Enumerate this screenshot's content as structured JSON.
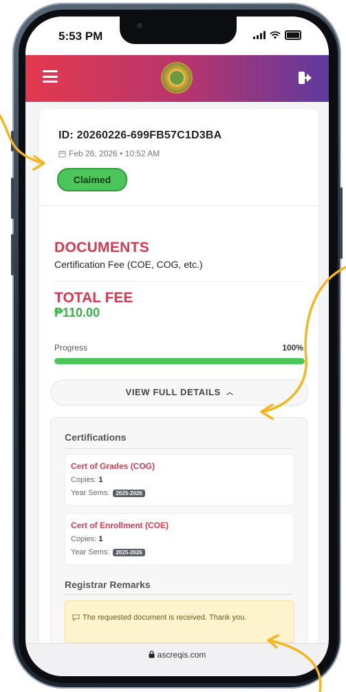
{
  "status_bar": {
    "time": "5:53 PM"
  },
  "header": {
    "menu_icon": "hamburger-icon",
    "logo_icon": "college-seal-logo",
    "logout_icon": "logout-icon"
  },
  "request": {
    "id_label": "ID: 20260226-699FB57C1D3BA",
    "date": "Feb 26, 2026 • 10:52 AM",
    "status": "Claimed"
  },
  "category": {
    "title": "DOCUMENTS",
    "subtitle": "Certification Fee (COE, COG, etc.)"
  },
  "total": {
    "label": "TOTAL FEE",
    "value": "₱110.00"
  },
  "progress": {
    "label": "Progress",
    "value_text": "100%",
    "percent": 100
  },
  "view_details": {
    "label": "VIEW FULL DETAILS"
  },
  "details": {
    "certifications_title": "Certifications",
    "certifications": [
      {
        "name": "Cert of Grades (COG)",
        "copies_label": "Copies:",
        "copies": "1",
        "year_label": "Year Sems:",
        "year": "2025-2026"
      },
      {
        "name": "Cert of Enrollment (COE)",
        "copies_label": "Copies:",
        "copies": "1",
        "year_label": "Year Sems:",
        "year": "2025-2026"
      }
    ],
    "remarks_title": "Registrar Remarks",
    "remark_text": "The requested document is received. Thank you."
  },
  "url_bar": {
    "url": "ascreqis.com"
  },
  "colors": {
    "accent_red": "#d8384f",
    "success_green": "#4cc65a",
    "annotation_yellow": "#f3b61f"
  }
}
